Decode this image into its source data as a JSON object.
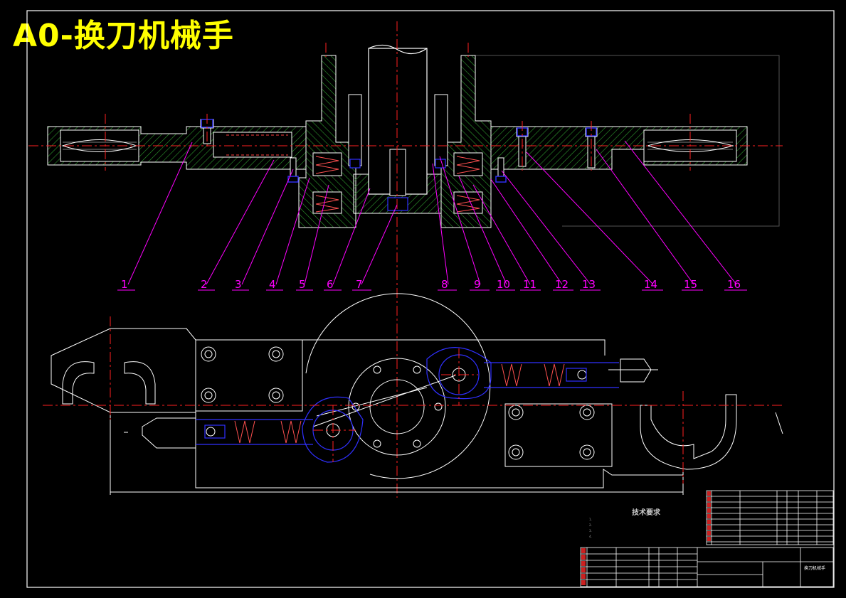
{
  "drawing": {
    "title": "A0-换刀机械手",
    "part_numbers": [
      "1",
      "2",
      "3",
      "4",
      "5",
      "6",
      "7",
      "8",
      "9",
      "10",
      "11",
      "12",
      "13",
      "14",
      "15",
      "16"
    ],
    "tech_requirements": {
      "heading": "技术要求",
      "lines": [
        "1.",
        "2.",
        "3.",
        "4."
      ]
    },
    "title_block": {
      "name": "换刀机械手"
    }
  },
  "colors": {
    "background": "#000000",
    "outline": "#ffffff",
    "hatch": "#2e9b2e",
    "center_line": "#ff2020",
    "leader": "#ff00ff",
    "hidden": "#3030ff",
    "title": "#ffff00",
    "border": "#ffffff"
  }
}
